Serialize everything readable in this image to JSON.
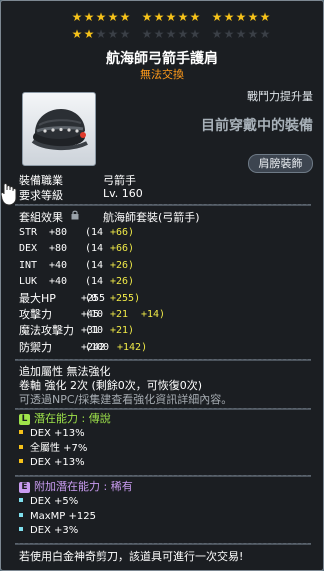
{
  "stars": {
    "row1_groups": [
      5,
      5,
      5
    ],
    "row1_filled": 15,
    "row2_groups": [
      5,
      5,
      5
    ],
    "row2_filled": 2,
    "colors": {
      "filled": "#f6c21a",
      "empty": "#3a3f46"
    }
  },
  "item": {
    "name": "航海師弓箭手護肩",
    "trade_status": "無法交換",
    "icon": "pirate-hat-shoulder-icon"
  },
  "compare": {
    "combat_power_label": "戰鬥力提升量",
    "equipped_now": "目前穿戴中的裝備",
    "slot": "肩膀裝飾"
  },
  "requirements": {
    "job_label": "裝備職業",
    "job_value": "弓箭手",
    "level_label": "要求等級",
    "level_value": "Lv. 160"
  },
  "set_effect": {
    "label": "套組效果",
    "name": "航海師套裝(弓箭手)"
  },
  "stats": [
    {
      "name": "STR",
      "total": "+80",
      "base": "(14",
      "bonus1": "+66)",
      "bonus2": ""
    },
    {
      "name": "DEX",
      "total": "+80",
      "base": "(14",
      "bonus1": "+66)",
      "bonus2": ""
    },
    {
      "name": "INT",
      "total": "+40",
      "base": "(14",
      "bonus1": "+26)",
      "bonus2": ""
    },
    {
      "name": "LUK",
      "total": "+40",
      "base": "(14",
      "bonus1": "+26)",
      "bonus2": ""
    },
    {
      "name": "最大HP",
      "total": "+255",
      "base": "(0",
      "bonus1": "+255)",
      "bonus2": ""
    },
    {
      "name": "攻擊力",
      "total": "+45",
      "base": "(10",
      "bonus1": "+21",
      "bonus2": "+14)"
    },
    {
      "name": "魔法攻擊力",
      "total": "+31",
      "base": "(10",
      "bonus1": "+21)",
      "bonus2": ""
    },
    {
      "name": "防禦力",
      "total": "+242",
      "base": "(100",
      "bonus1": "+142)",
      "bonus2": ""
    }
  ],
  "extra": {
    "additional": "追加屬性 無法強化",
    "scroll": "卷軸 強化 2次 (剩餘0次，可恢復0次)",
    "npc_hint": "可透過NPC/採集建查看強化資訊詳細內容。"
  },
  "potential": {
    "badge": "L",
    "title": "潛在能力 : 傳說",
    "color": "#9ee34a",
    "lines": [
      "DEX +13%",
      "全屬性 +7%",
      "DEX +13%"
    ]
  },
  "bonus_potential": {
    "badge": "E",
    "title": "附加潛在能力 : 稀有",
    "color": "#c89bf0",
    "bullet_color": "#7fe0ee",
    "lines": [
      "DEX +5%",
      "MaxMP +125",
      "DEX +3%"
    ]
  },
  "footer": "若使用白金神奇剪刀，該道具可進行一次交易!"
}
